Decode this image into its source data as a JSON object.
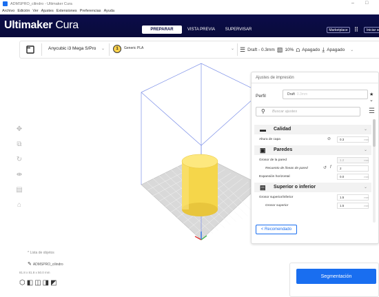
{
  "window": {
    "title": "ADMSPRO_cilindro - Ultimaker Cura",
    "minimize": "–",
    "maximize": "□"
  },
  "menu": [
    "Archivo",
    "Edición",
    "Ver",
    "Ajustes",
    "Extensiones",
    "Preferencias",
    "Ayuda"
  ],
  "header": {
    "logo_bold": "Ultimaker",
    "logo_light": " Cura",
    "stages": {
      "prepare": "PREPARAR",
      "preview": "VISTA PREVIA",
      "monitor": "SUPERVISAR"
    },
    "marketplace": "Marketplace",
    "signin": "Iniciar sesión",
    "accent": "#0a0b42"
  },
  "toolbar": {
    "printer": "Anycubic i3 Mega S/Pro",
    "material_index": "1",
    "material": "Generic PLA",
    "profile": "Draft - 0.3mm",
    "infill": "10%",
    "support": "Apagado",
    "adhesion": "Apagado"
  },
  "panel": {
    "title": "Ajustes de impresión",
    "profile_label": "Perfil",
    "profile_value": "Draft",
    "profile_extra": "0.3mm",
    "search_placeholder": "Buscar ajustes",
    "categories": {
      "quality": {
        "label": "Calidad"
      },
      "walls": {
        "label": "Paredes"
      },
      "topbottom": {
        "label": "Superior o inferior"
      }
    },
    "rows": {
      "layer_height": {
        "label": "Altura de capa",
        "value": "0.3",
        "unit": "mm"
      },
      "wall_thickness": {
        "label": "Grosor de la pared",
        "value": "1.2",
        "unit": "mm"
      },
      "wall_line_count": {
        "label": "Recuento de líneas de pared",
        "value": "2",
        "unit": ""
      },
      "horizontal_expansion": {
        "label": "Expansión horizontal",
        "value": "0.0",
        "unit": "mm"
      },
      "topbottom_thickness": {
        "label": "Grosor superior/inferior",
        "value": "1.5",
        "unit": "mm"
      },
      "top_thickness": {
        "label": "Grosor superior",
        "value": "1.5",
        "unit": "mm"
      }
    },
    "recommended": "< Recomendado"
  },
  "objects": {
    "list_toggle": "Lista de objetos",
    "name": "ADMSPRO_cilindro",
    "dims": "81.8 x 81.8 x 50.0 mm"
  },
  "slice_button": "Segmentación",
  "colors": {
    "object": "#f5d64a",
    "primary": "#196ef0"
  }
}
